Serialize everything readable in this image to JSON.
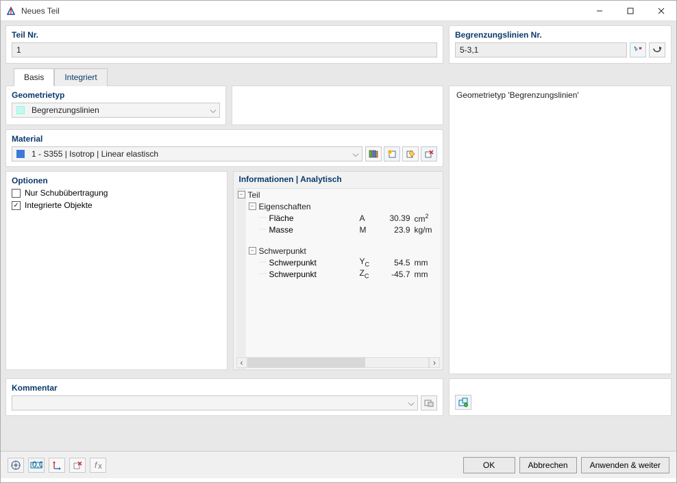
{
  "window": {
    "title": "Neues Teil"
  },
  "teil": {
    "label": "Teil Nr.",
    "value": "1"
  },
  "begrenzung": {
    "label": "Begrenzungslinien Nr.",
    "value": "5-3,1"
  },
  "tabs": {
    "basis": "Basis",
    "integriert": "Integriert"
  },
  "geometry": {
    "label": "Geometrietyp",
    "value": "Begrenzungslinien",
    "swatch": "#c8f5f0"
  },
  "material": {
    "label": "Material",
    "value": "1 - S355 | Isotrop | Linear elastisch",
    "swatch": "#3b7bd8"
  },
  "options": {
    "label": "Optionen",
    "shear": {
      "text": "Nur Schubübertragung",
      "checked": false
    },
    "integrated": {
      "text": "Integrierte Objekte",
      "checked": true
    }
  },
  "info": {
    "label": "Informationen | Analytisch",
    "teil": "Teil",
    "eigenschaften": "Eigenschaften",
    "schwerpunkt": "Schwerpunkt",
    "rows": {
      "area": {
        "name": "Fläche",
        "sym": "A",
        "val": "30.39",
        "unit_html": "cm",
        "sup": "2"
      },
      "mass": {
        "name": "Masse",
        "sym": "M",
        "val": "23.9",
        "unit": "kg/m"
      },
      "cy": {
        "name": "Schwerpunkt",
        "sym": "Y",
        "sub": "C",
        "val": "54.5",
        "unit": "mm"
      },
      "cz": {
        "name": "Schwerpunkt",
        "sym": "Z",
        "sub": "C",
        "val": "-45.7",
        "unit": "mm"
      }
    }
  },
  "rightpanel": {
    "text": "Geometrietyp 'Begrenzungslinien'"
  },
  "comment": {
    "label": "Kommentar",
    "value": ""
  },
  "buttons": {
    "ok": "OK",
    "cancel": "Abbrechen",
    "apply": "Anwenden & weiter"
  }
}
